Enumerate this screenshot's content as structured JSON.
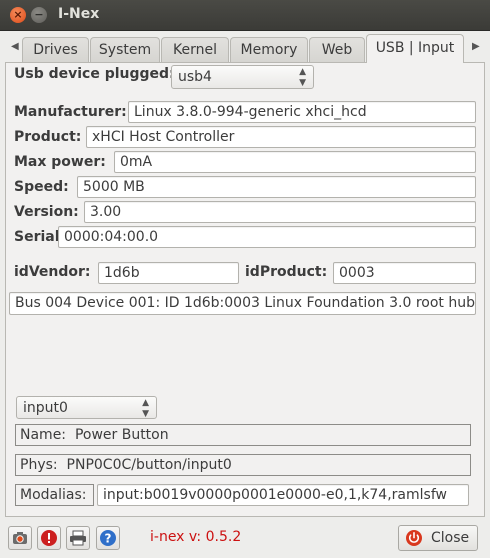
{
  "window": {
    "title": "I-Nex",
    "close_glyph": "×",
    "minimize_glyph": "−"
  },
  "tabs": [
    {
      "label": "Drives"
    },
    {
      "label": "System"
    },
    {
      "label": "Kernel"
    },
    {
      "label": "Memory"
    },
    {
      "label": "Web"
    },
    {
      "label": "USB | Input",
      "active": true
    }
  ],
  "usb": {
    "plugged_label": "Usb device plugged:",
    "plugged_value": "usb4",
    "manufacturer_label": "Manufacturer:",
    "manufacturer_value": "Linux 3.8.0-994-generic xhci_hcd",
    "product_label": "Product:",
    "product_value": "xHCI Host Controller",
    "maxpower_label": "Max power:",
    "maxpower_value": "0mA",
    "speed_label": "Speed:",
    "speed_value": "5000 MB",
    "version_label": "Version:",
    "version_value": "3.00",
    "serial_label": "Serial",
    "serial_value": "0000:04:00.0",
    "idvendor_label": "idVendor:",
    "idvendor_value": "1d6b",
    "idproduct_label": "idProduct:",
    "idproduct_value": "0003",
    "bus_info": "Bus 004 Device 001: ID 1d6b:0003 Linux Foundation 3.0 root hub"
  },
  "input": {
    "device_value": "input0",
    "name_label": "Name:",
    "name_value": "Power Button",
    "phys_label": "Phys:",
    "phys_value": "PNP0C0C/button/input0",
    "modalias_label": "Modalias:",
    "modalias_value": "input:b0019v0000p0001e0000-e0,1,k74,ramlsfw"
  },
  "footer": {
    "version_text": "i-nex v: 0.5.2",
    "close_label": "Close",
    "icons": [
      "camera-icon",
      "report-bug-icon",
      "print-icon",
      "help-icon",
      "power-icon"
    ]
  },
  "colors": {
    "accent_red": "#cc1111",
    "titlebar": "#3c3b37",
    "close_orange": "#e05a24"
  }
}
